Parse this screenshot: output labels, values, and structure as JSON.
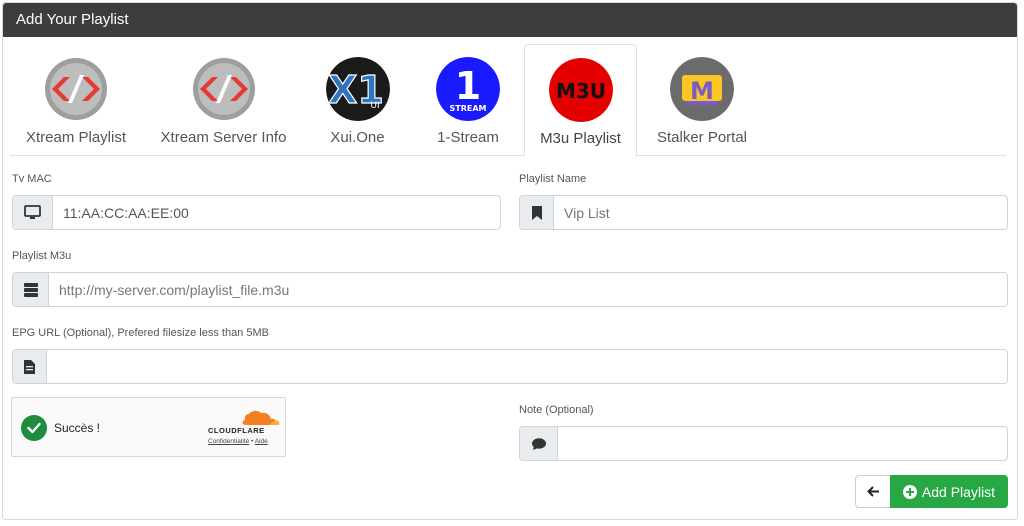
{
  "header": {
    "title": "Add Your Playlist"
  },
  "tabs": [
    {
      "label": "Xtream Playlist",
      "icon": "xtream-logo-icon"
    },
    {
      "label": "Xtream Server Info",
      "icon": "xtream-logo-icon"
    },
    {
      "label": "Xui.One",
      "icon": "xui-one-logo-icon",
      "logo_text": "X1",
      "logo_sub": "UI"
    },
    {
      "label": "1-Stream",
      "icon": "one-stream-logo-icon",
      "logo_text": "1",
      "logo_sub": "STREAM"
    },
    {
      "label": "M3u Playlist",
      "icon": "m3u-logo-icon",
      "logo_text": "M3U",
      "active": true
    },
    {
      "label": "Stalker Portal",
      "icon": "stalker-logo-icon",
      "logo_text": "M"
    }
  ],
  "form": {
    "tv_mac": {
      "label": "Tv MAC",
      "value": "11:AA:CC:AA:EE:00",
      "icon": "monitor-icon"
    },
    "playlist_name": {
      "label": "Playlist Name",
      "placeholder": "Vip List",
      "icon": "bookmark-icon"
    },
    "playlist_m3u": {
      "label": "Playlist M3u",
      "placeholder": "http://my-server.com/playlist_file.m3u",
      "icon": "server-icon"
    },
    "epg_url": {
      "label": "EPG URL (Optional), Prefered filesize less than 5MB",
      "placeholder": "",
      "icon": "file-icon"
    },
    "note": {
      "label": "Note (Optional)",
      "placeholder": "",
      "icon": "comment-icon"
    }
  },
  "captcha": {
    "status": "Succès !",
    "brand": "CLOUDFLARE",
    "privacy_link": "Confidentialité",
    "separator": "•",
    "help_link": "Aide"
  },
  "actions": {
    "add_label": "Add Playlist"
  },
  "colors": {
    "header_bg": "#3d3d3d",
    "accent_green": "#28a745",
    "xtream_red": "#e53935",
    "one_stream_blue": "#1a1aff",
    "m3u_red": "#e50000",
    "stalker_gold": "#f9c623"
  }
}
